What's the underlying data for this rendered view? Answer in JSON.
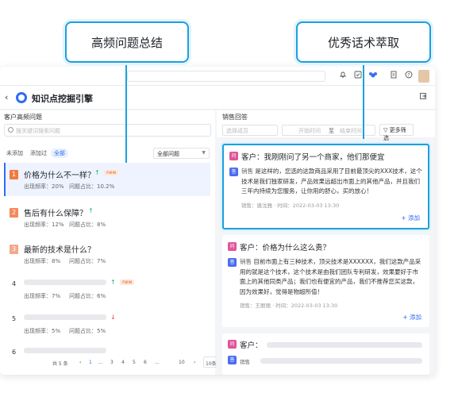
{
  "callouts": {
    "left": "高频问题总结",
    "right": "优秀话术萃取"
  },
  "app": {
    "title": "知识点挖掘引擎",
    "back_icon": "‹"
  },
  "left_panel": {
    "section_title": "客户高频问题",
    "search_placeholder": "搜关键词搜索问题",
    "filters": [
      "未添加",
      "添加过",
      "全部"
    ],
    "active_filter": "全部",
    "select_value": "全部问题",
    "questions": [
      {
        "num": "1",
        "title": "价格为什么不一样？",
        "trend": "up",
        "new": "new",
        "freq": "出现频率：20%",
        "ratio": "问题占比：10.2%",
        "color": "#f07b3f"
      },
      {
        "num": "2",
        "title": "售后有什么保障？",
        "trend": "up",
        "new": "",
        "freq": "出现频率：12%",
        "ratio": "问题占比：8%",
        "color": "#f58a5c"
      },
      {
        "num": "3",
        "title": "最新的技术是什么？",
        "trend": "",
        "new": "",
        "freq": "出现频率：8%",
        "ratio": "问题占比：7%",
        "color": "#f5a88b"
      },
      {
        "num": "4",
        "title": "",
        "trend": "up",
        "new": "new",
        "freq": "出现频率：7%",
        "ratio": "问题占比：6%",
        "color": ""
      },
      {
        "num": "5",
        "title": "",
        "trend": "down",
        "new": "",
        "freq": "出现频率：5%",
        "ratio": "问题占比：5%",
        "color": ""
      },
      {
        "num": "6",
        "title": "",
        "trend": "",
        "new": "",
        "freq": "",
        "ratio": "",
        "color": ""
      }
    ],
    "pager": {
      "total": "共 5 条",
      "prev": "‹",
      "pages": [
        "1",
        "...",
        "3",
        "4",
        "5",
        "6",
        "...",
        "10"
      ],
      "active": "1",
      "next": "›",
      "size": "10条"
    }
  },
  "right_panel": {
    "section_title": "销售回答",
    "select_placeholder": "选择成员",
    "date_start": "开始时间",
    "date_sep": "至",
    "date_end": "结束时间",
    "more_filter": "更多筛选",
    "cards": [
      {
        "q_badge": "问",
        "a_badge": "答",
        "question": "客户：我刚刚问了另一个商家，他们那便宜",
        "speaker": "销售",
        "answer": "是这样的，您选的这款商品采用了目前最顶尖的XXX技术，这个技术是我们独家研发，产品效果远超出市面上的其他产品，并且我们三年内持续为您服务，让你用的舒心，买的放心！",
        "meta": "销售：唐沈雅 · 时间：2022-03-03 13:30",
        "add": "+ 添加"
      },
      {
        "q_badge": "问",
        "a_badge": "答",
        "question": "客户：价格为什么这么贵？",
        "speaker": "销售",
        "answer": "目前市面上有三种技术，顶尖技术是XXXXXX，我们这款产品采用的就是这个技术，这个技术是由我们团队专利研发，效果要好于市面上的其他同类产品；我们也有便宜的产品，我们不推荐您买这款，因为效果好，觉得是物超所值！",
        "meta": "销售：王丽丽 · 时间：2022-03-03 13:30",
        "add": "+ 添加"
      },
      {
        "q_badge": "问",
        "a_badge": "答",
        "question": "客户：",
        "speaker": "销售",
        "answer": "",
        "meta": "",
        "add": ""
      }
    ]
  },
  "colors": {
    "accent": "#2f6bf5",
    "callout": "#1aa1e0"
  }
}
